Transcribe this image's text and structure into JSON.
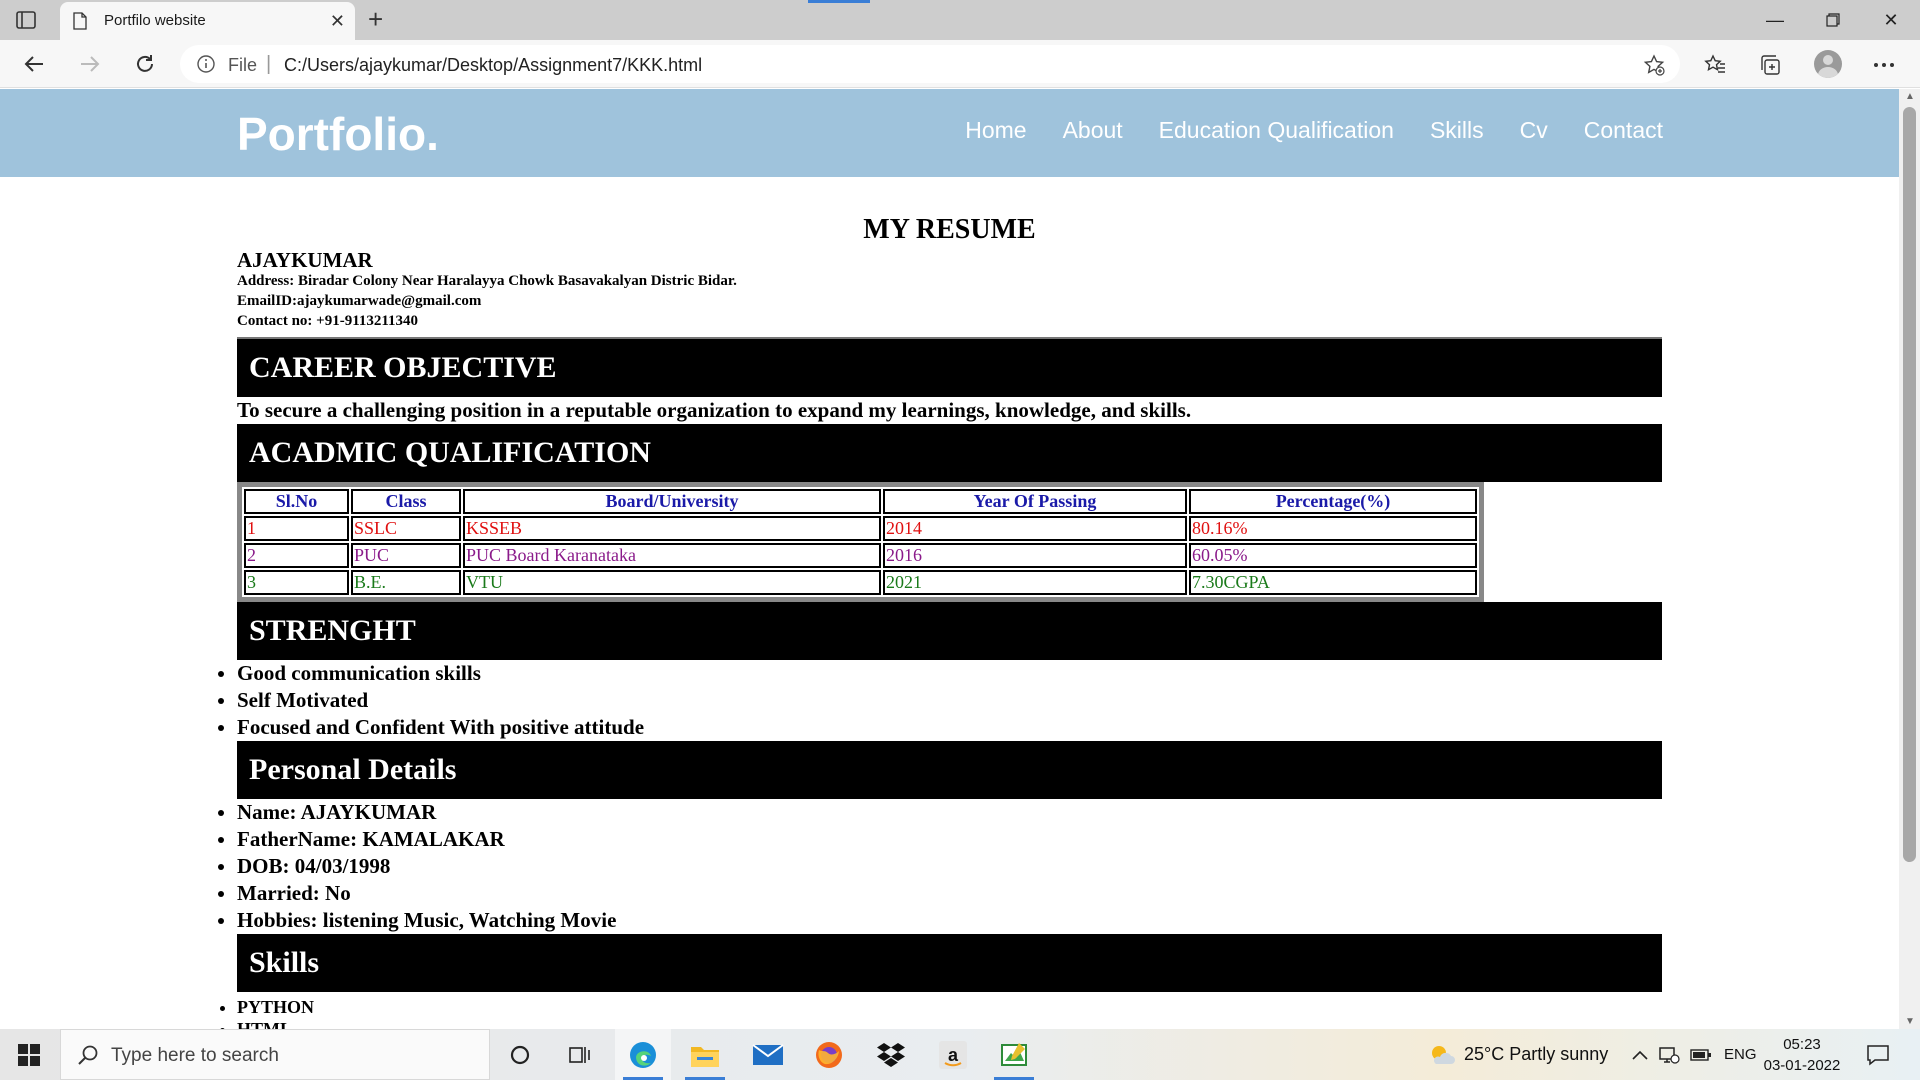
{
  "browser": {
    "tab_title": "Portfilo website",
    "address_prefix": "File",
    "address_sep": "|",
    "url": "C:/Users/ajaykumar/Desktop/Assignment7/KKK.html"
  },
  "site": {
    "logo": "Portfolio.",
    "nav": [
      "Home",
      "About",
      "Education Qualification",
      "Skills",
      "Cv",
      "Contact"
    ]
  },
  "resume": {
    "title": "MY RESUME",
    "name": "AJAYKUMAR",
    "address": "Address: Biradar Colony Near Haralayya Chowk Basavakalyan Distric Bidar.",
    "email": "EmailID:ajaykumarwade@gmail.com",
    "contact": "Contact no: +91-9113211340",
    "career_heading": "CAREER OBJECTIVE",
    "career_text": "To secure a challenging position in a reputable organization to expand my learnings, knowledge, and skills.",
    "academic_heading": "ACADMIC QUALIFICATION",
    "table": {
      "headers": [
        "Sl.No",
        "Class",
        "Board/University",
        "Year Of Passing",
        "Percentage(%)"
      ],
      "rows": [
        [
          "1",
          "SSLC",
          "KSSEB",
          "2014",
          "80.16%"
        ],
        [
          "2",
          "PUC",
          "PUC Board Karanataka",
          "2016",
          "60.05%"
        ],
        [
          "3",
          "B.E.",
          "VTU",
          "2021",
          "7.30CGPA"
        ]
      ],
      "row_colors": [
        "#e01010",
        "#8a1a8a",
        "#1a7a1a"
      ]
    },
    "strength_heading": "STRENGHT",
    "strengths": [
      "Good communication skills",
      "Self Motivated",
      "Focused and Confident With positive attitude"
    ],
    "personal_heading": "Personal Details",
    "personal": [
      "Name: AJAYKUMAR",
      "FatherName: KAMALAKAR",
      "DOB: 04/03/1998",
      "Married: No",
      "Hobbies: listening Music, Watching Movie"
    ],
    "skills_heading": "Skills",
    "skills": [
      "PYTHON",
      "HTML"
    ]
  },
  "taskbar": {
    "search_placeholder": "Type here to search",
    "weather": "25°C  Partly sunny",
    "language": "ENG",
    "time": "05:23",
    "date": "03-01-2022"
  },
  "colors": {
    "header_bg": "#9fc3dc",
    "table_header_text": "#1a1aa8"
  }
}
